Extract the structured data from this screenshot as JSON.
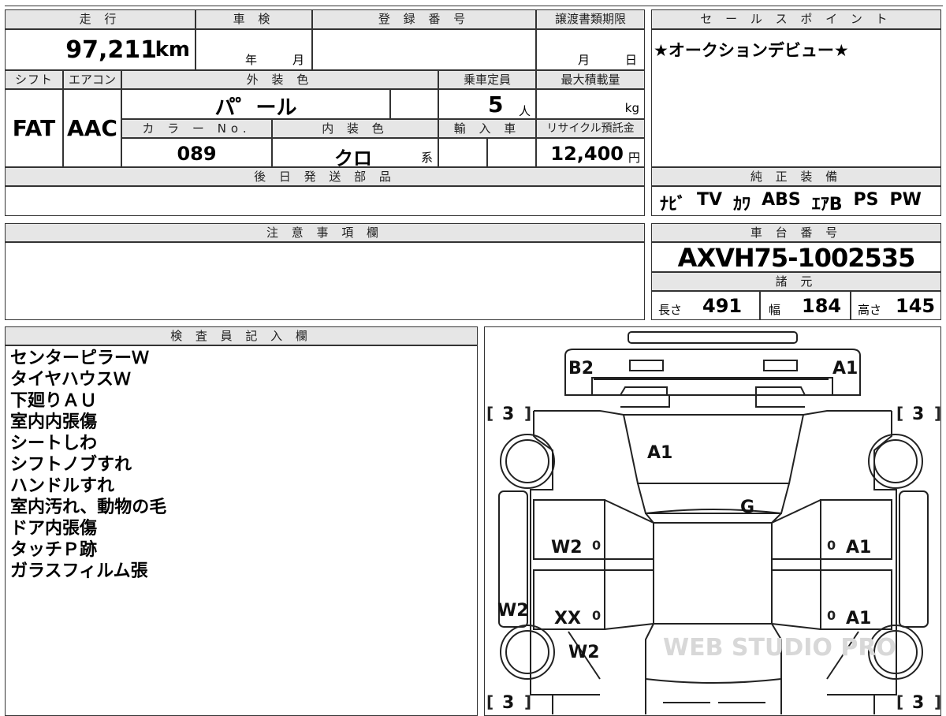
{
  "vehicle": {
    "mileage_label": "走 行",
    "mileage_value": "97,211",
    "mileage_unit": "km",
    "inspection_label": "車 検",
    "inspection_year_unit": "年",
    "inspection_month_unit": "月",
    "registration_label": "登 録 番 号",
    "transfer_label": "譲渡書類期限",
    "transfer_month_unit": "月",
    "transfer_day_unit": "日",
    "shift_label": "シフト",
    "shift_value": "FAT",
    "aircon_label": "エアコン",
    "aircon_value": "AAC",
    "exterior_color_label": "外 装 色",
    "exterior_color_value": "パ゜ール",
    "capacity_label": "乗車定員",
    "capacity_value": "5",
    "capacity_unit": "人",
    "max_load_label": "最大積載量",
    "max_load_unit": "kg",
    "color_no_label": "カ ラ ー No.",
    "color_no_value": "089",
    "interior_color_label": "内 装 色",
    "interior_color_value": "クロ",
    "interior_color_unit": "系",
    "import_label": "輸 入 車",
    "recycle_label": "リサイクル預託金",
    "recycle_value": "12,400",
    "recycle_unit": "円",
    "later_parts_label": "後 日 発 送 部 品",
    "cautions_label": "注 意 事 項 欄"
  },
  "sales_points": {
    "label": "セ ー ル ス ポ イ ン ト",
    "text": "★オークションデビュー★"
  },
  "equipment": {
    "label": "純 正 装 備",
    "items": [
      "ﾅﾋﾞ",
      "TV",
      "ｶﾜ",
      "ABS",
      "ｴｱB",
      "PS",
      "PW"
    ]
  },
  "chassis": {
    "label": "車 台 番 号",
    "number": "AXVH75-1002535",
    "specs_label": "諸 元",
    "length_label": "長さ",
    "length_value": "491",
    "width_label": "幅",
    "width_value": "184",
    "height_label": "高さ",
    "height_value": "145"
  },
  "inspector": {
    "label": "検 査 員 記 入 欄",
    "lines": [
      "センターピラーＷ",
      "タイヤハウスＷ",
      "下廻りＡＵ",
      "室内内張傷",
      "シートしわ",
      "シフトノブすれ",
      "ハンドルすれ",
      "室内汚れ、動物の毛",
      "ドア内張傷",
      "タッチＰ跡",
      "ガラスフィルム張"
    ]
  },
  "diagram": {
    "marks": {
      "rear_left": "B2",
      "rear_right": "A1",
      "rear_glass": "A1",
      "roof": "G",
      "left_rear_door": "W2",
      "left_front_door": "XX",
      "left_pillar": "W2",
      "left_front_fender": "W2",
      "right_rear_door": "A1",
      "right_front_door": "A1",
      "door_zero": "0",
      "tread_label": "3"
    },
    "watermark": "WEB STUDIO PRO"
  }
}
